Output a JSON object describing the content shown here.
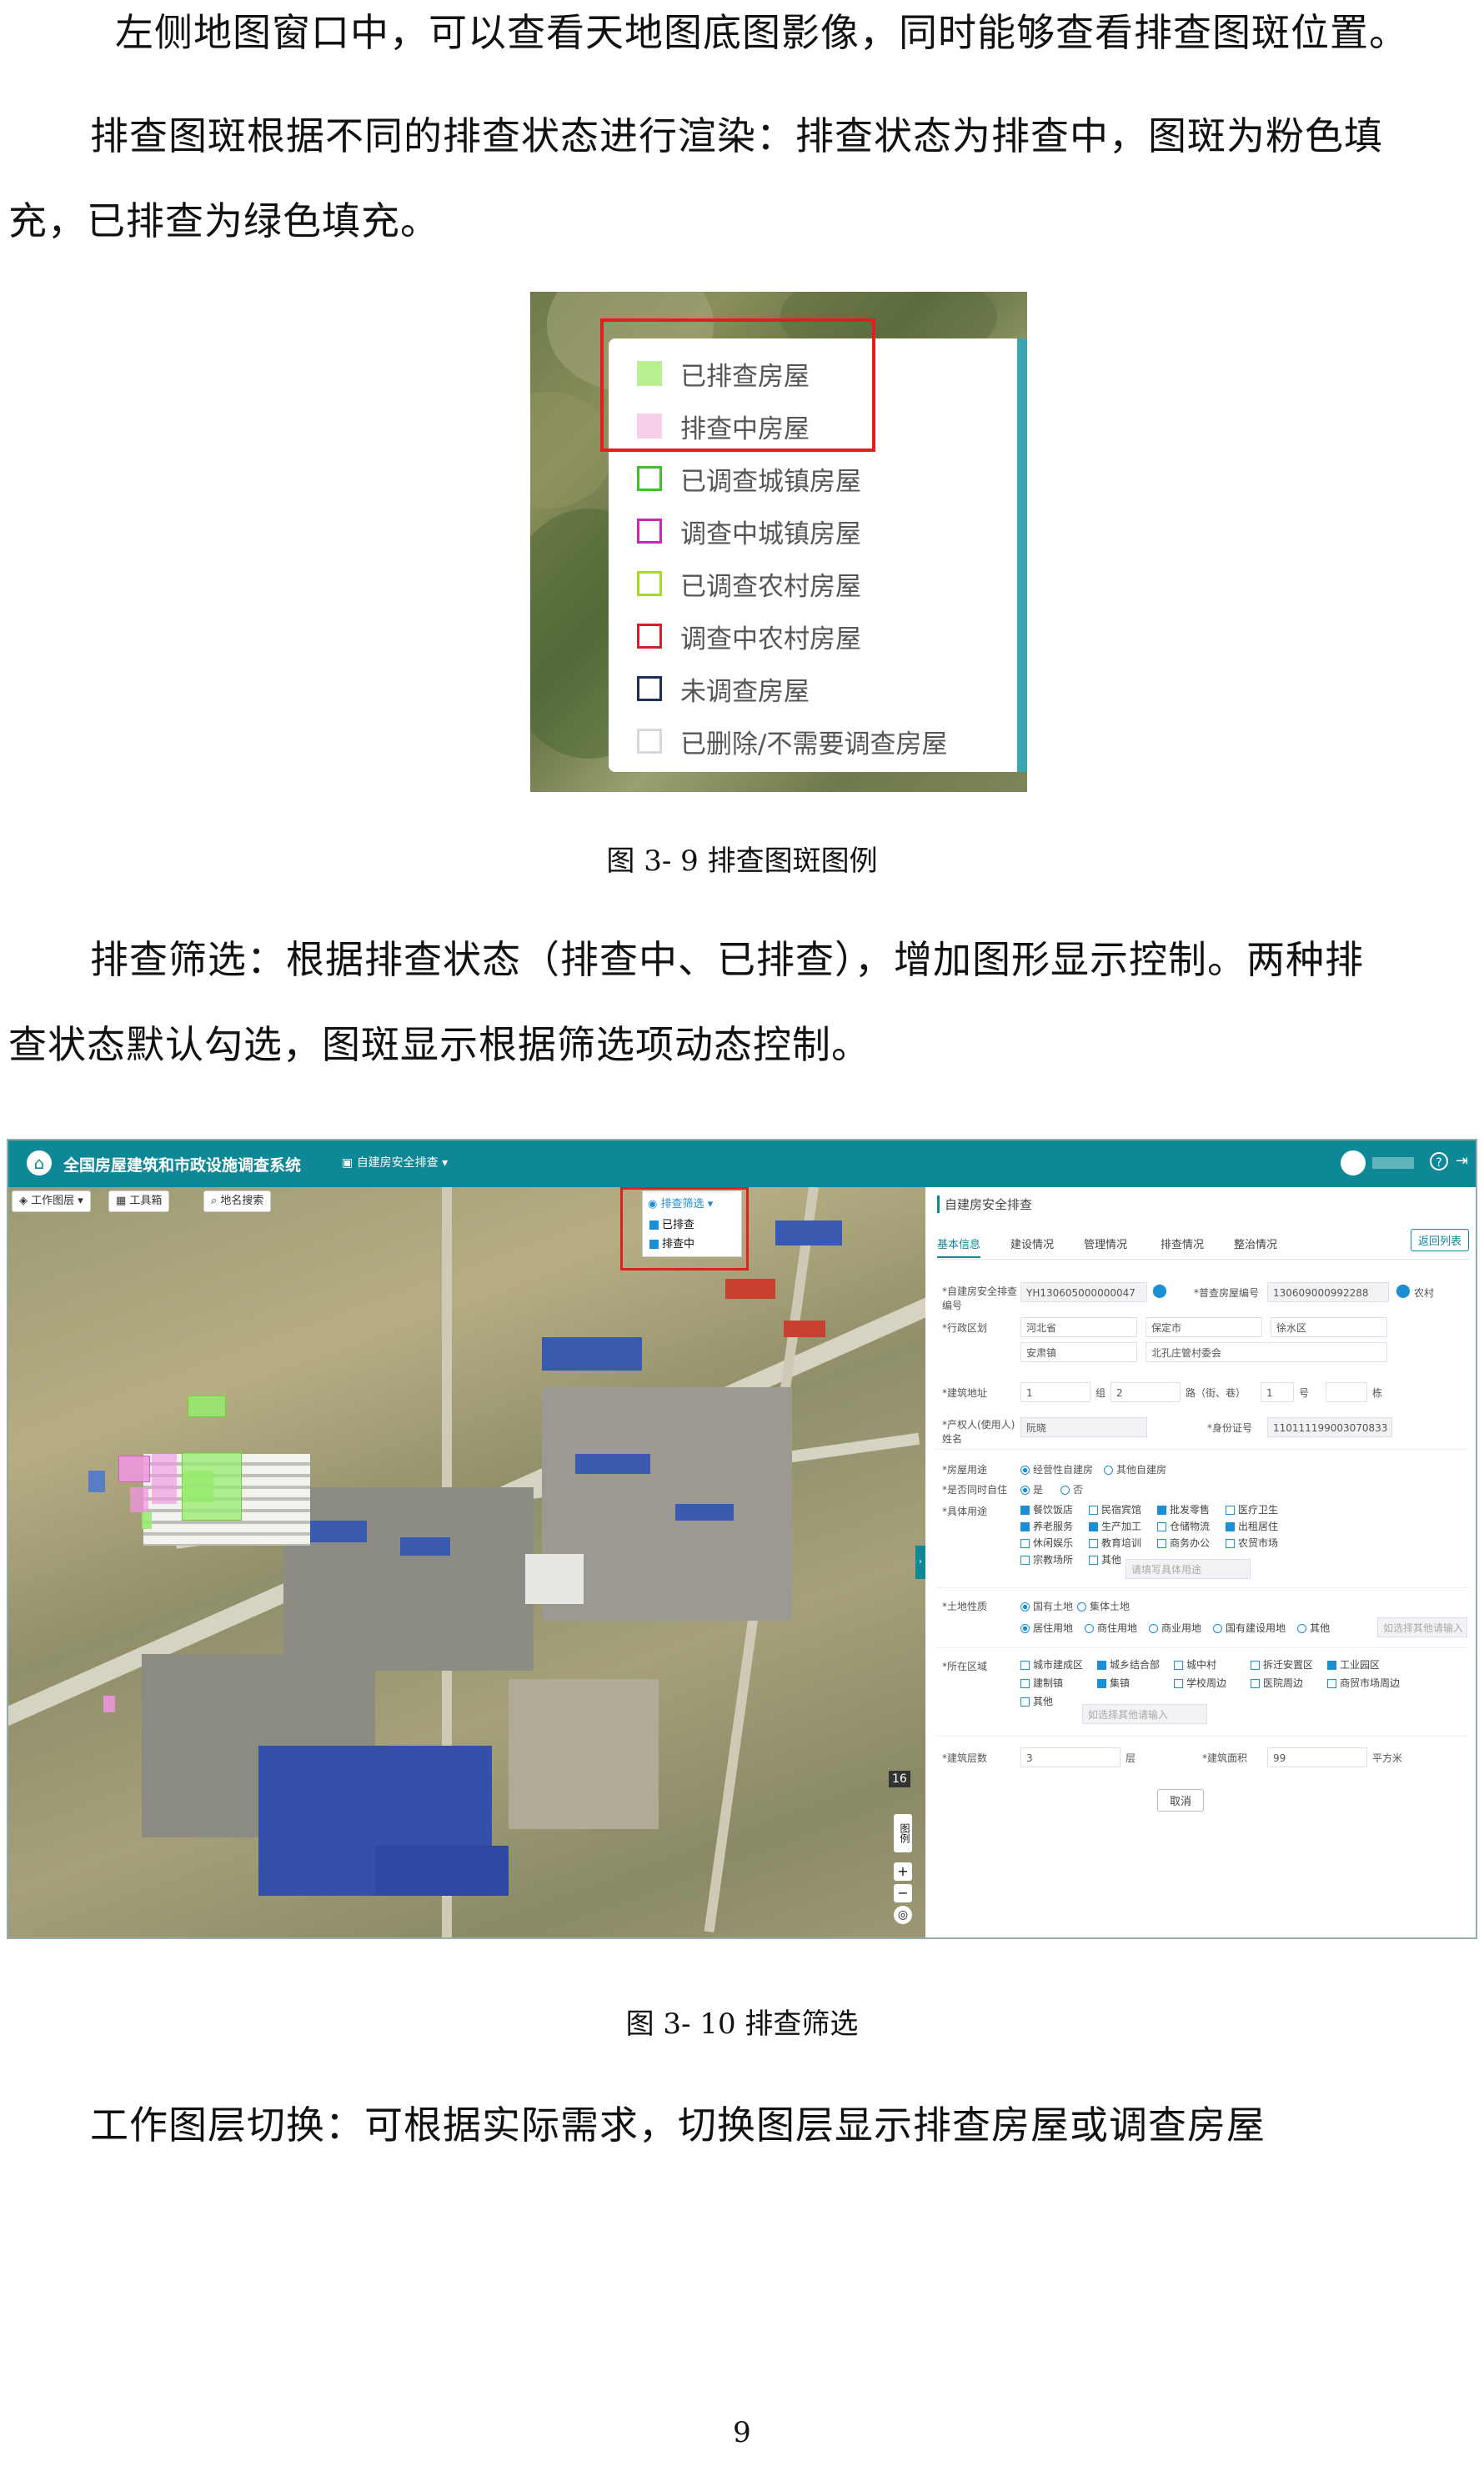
{
  "paragraphs": {
    "p1": "左侧地图窗口中，可以查看天地图底图影像，同时能够查看排查图斑位置。",
    "p2_line1": "排查图斑根据不同的排查状态进行渲染：排查状态为排查中，图斑为粉色填",
    "p2_line2": "充，已排查为绿色填充。",
    "p3_line1": "排查筛选：根据排查状态（排查中、已排查），增加图形显示控制。两种排",
    "p3_line2": "查状态默认勾选，图斑显示根据筛选项动态控制。",
    "p4": "工作图层切换：可根据实际需求，切换图层显示排查房屋或调查房屋"
  },
  "captions": {
    "fig1": "图 3- 9 排查图斑图例",
    "fig2": "图 3- 10 排查筛选"
  },
  "page_number": "9",
  "legend": {
    "items": [
      {
        "label": "已排查房屋",
        "fill": "#b6f08f",
        "border": "#b6f08f"
      },
      {
        "label": "排查中房屋",
        "fill": "#f7cde8",
        "border": "#f7cde8"
      },
      {
        "label": "已调查城镇房屋",
        "fill": "#ffffff",
        "border": "#3fbf2a"
      },
      {
        "label": "调查中城镇房屋",
        "fill": "#ffffff",
        "border": "#c52ab8"
      },
      {
        "label": "已调查农村房屋",
        "fill": "#ffffff",
        "border": "#a9d826"
      },
      {
        "label": "调查中农村房屋",
        "fill": "#ffffff",
        "border": "#d4222a"
      },
      {
        "label": "未调查房屋",
        "fill": "#ffffff",
        "border": "#1d2f5a"
      },
      {
        "label": "已删除/不需要调查房屋",
        "fill": "#ffffff",
        "border": "#d8d8d8"
      }
    ]
  },
  "app": {
    "title": "全国房屋建筑和市政设施调查系统",
    "module": "自建房安全排查",
    "toolbar": {
      "work_layer": "工作图层",
      "toolbox": "工具箱",
      "place_search": "地名搜索",
      "filter": "排查筛选",
      "filter_options": [
        "已排查",
        "排查中"
      ]
    },
    "map_controls": {
      "legend": "图例",
      "zoom_in": "+",
      "zoom_out": "−",
      "badge": "16"
    },
    "form": {
      "title": "自建房安全排查",
      "tabs": [
        "基本信息",
        "建设情况",
        "管理情况",
        "排查情况",
        "整治情况"
      ],
      "back_button": "返回列表",
      "code_label": "*自建房安全排查编号",
      "code_value": "YH130605000000047",
      "survey_label": "*普查房屋编号",
      "survey_value": "130609000992288",
      "rural": "农村",
      "region_label": "*行政区划",
      "province": "河北省",
      "city": "保定市",
      "district": "徐水区",
      "town": "安肃镇",
      "village": "北孔庄管村委会",
      "address_label": "*建筑地址",
      "addr_1": "1",
      "addr_group": "组",
      "addr_2": "2",
      "addr_road": "路（街、巷）",
      "addr_3": "1",
      "addr_no": "号",
      "addr_bldg": "栋",
      "owner_label": "*产权人(使用人)姓名",
      "owner_value": "阮晓",
      "id_label": "*身份证号",
      "id_value": "110111199003070833",
      "use_label": "*房屋用途",
      "use_opt1": "经营性自建房",
      "use_opt2": "其他自建房",
      "occupied_label": "*是否同时自住",
      "yes": "是",
      "no": "否",
      "purpose_label": "*具体用途",
      "purposes": [
        "餐饮饭店",
        "民宿宾馆",
        "批发零售",
        "医疗卫生",
        "养老服务",
        "生产加工",
        "仓储物流",
        "出租居住",
        "休闲娱乐",
        "教育培训",
        "商务办公",
        "农贸市场",
        "宗教场所",
        "其他"
      ],
      "purpose_placeholder": "请填写具体用途",
      "land_label": "*土地性质",
      "land_opt1": "国有土地",
      "land_opt2": "集体土地",
      "land_uses": [
        "居住用地",
        "商住用地",
        "商业用地",
        "国有建设用地",
        "其他"
      ],
      "land_placeholder": "如选择其他请输入",
      "area_label": "*所在区域",
      "areas": [
        "城市建成区",
        "城乡结合部",
        "城中村",
        "拆迁安置区",
        "工业园区",
        "建制镇",
        "集镇",
        "学校周边",
        "医院周边",
        "商贸市场周边",
        "其他"
      ],
      "area_placeholder": "如选择其他请输入",
      "floors_label": "*建筑层数",
      "floors_value": "3",
      "floors_unit": "层",
      "building_area_label": "*建筑面积",
      "building_area_value": "99",
      "area_unit": "平方米",
      "cancel": "取消"
    }
  }
}
